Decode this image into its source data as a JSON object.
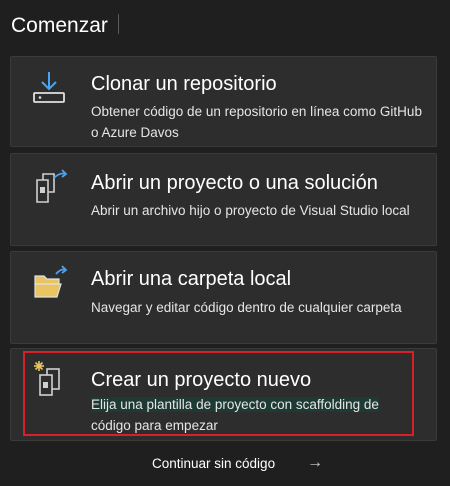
{
  "page": {
    "title": "Comenzar"
  },
  "cards": {
    "clone": {
      "icon": "download-clone-icon",
      "heading": "Clonar un repositorio",
      "description": "Obtener código de un repositorio en línea como GitHub o Azure Davos"
    },
    "open_project": {
      "icon": "open-project-icon",
      "heading": "Abrir un proyecto o una solución",
      "description": "Abrir un archivo hijo o proyecto de Visual Studio local"
    },
    "open_folder": {
      "icon": "open-folder-icon",
      "heading": "Abrir una carpeta local",
      "description": "Navegar y editar código dentro de cualquier carpeta"
    },
    "new_project": {
      "icon": "new-project-icon",
      "heading": "Crear un proyecto nuevo",
      "description_line1": "Elija una plantilla de proyecto con scaffolding de",
      "description_line2": "código para empezar"
    }
  },
  "footer": {
    "continue_label": "Continuar sin código",
    "continue_arrow": "→"
  },
  "colors": {
    "background": "#1f1f1f",
    "card_background": "#2d2d2d",
    "highlight_border": "#d8202a",
    "icon_accent_blue": "#4aa3f0",
    "folder_yellow": "#e8c463"
  }
}
